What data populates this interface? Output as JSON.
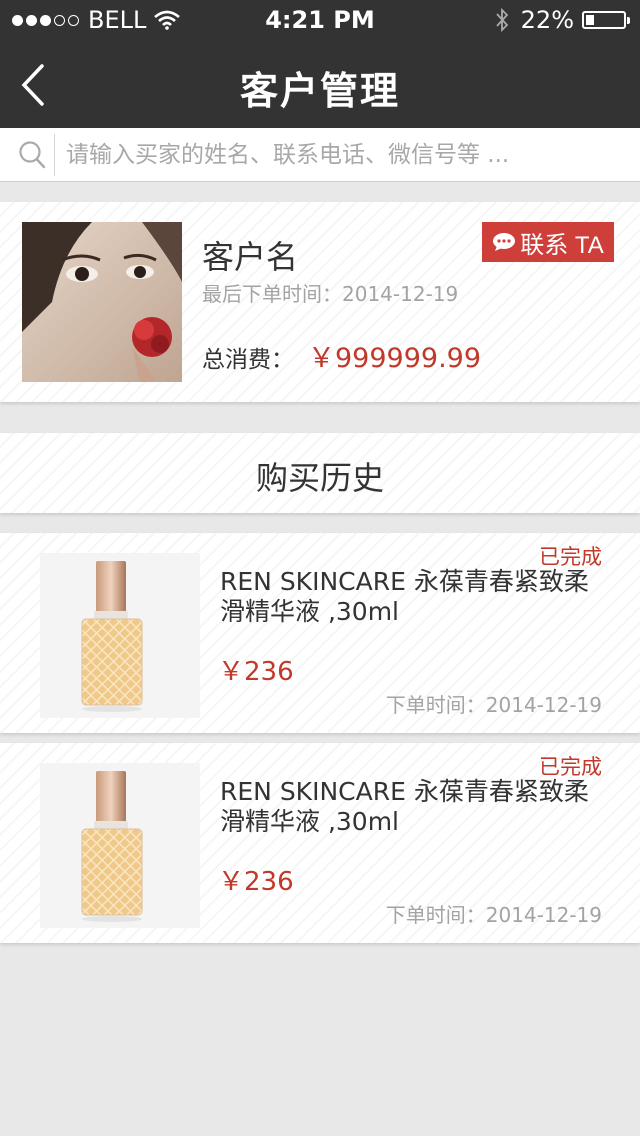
{
  "status_bar": {
    "carrier": "BELL",
    "time": "4:21 PM",
    "battery_percent": "22%",
    "battery_level": 0.22,
    "signal_dots_filled": 3,
    "icons": [
      "signal-dots-icon",
      "wifi-icon",
      "bluetooth-icon",
      "battery-icon"
    ]
  },
  "nav": {
    "title": "客户管理",
    "back_icon": "back-arrow-icon"
  },
  "search": {
    "placeholder": "请输入买家的姓名、联系电话、微信号等 ...",
    "value": "",
    "icon": "search-icon"
  },
  "customer": {
    "name": "客户名",
    "last_order": "最后下单时间：2014-12-19",
    "total_label": "总消费：",
    "total_value": "￥999999.99",
    "contact_label": "联系 TA",
    "contact_icon": "chat-bubble-icon"
  },
  "history": {
    "title": "购买历史"
  },
  "orders": [
    {
      "status": "已完成",
      "name": "REN SKINCARE 永葆青春紧致柔滑精华液 ,30ml",
      "price": "￥236",
      "time": "下单时间：2014-12-19"
    },
    {
      "status": "已完成",
      "name": "REN SKINCARE 永葆青春紧致柔滑精华液 ,30ml",
      "price": "￥236",
      "time": "下单时间：2014-12-19"
    }
  ],
  "colors": {
    "nav_bg": "#333333",
    "accent_red": "#c0392b",
    "button_red": "#cf3f3a",
    "page_bg": "#e8e8e8"
  }
}
